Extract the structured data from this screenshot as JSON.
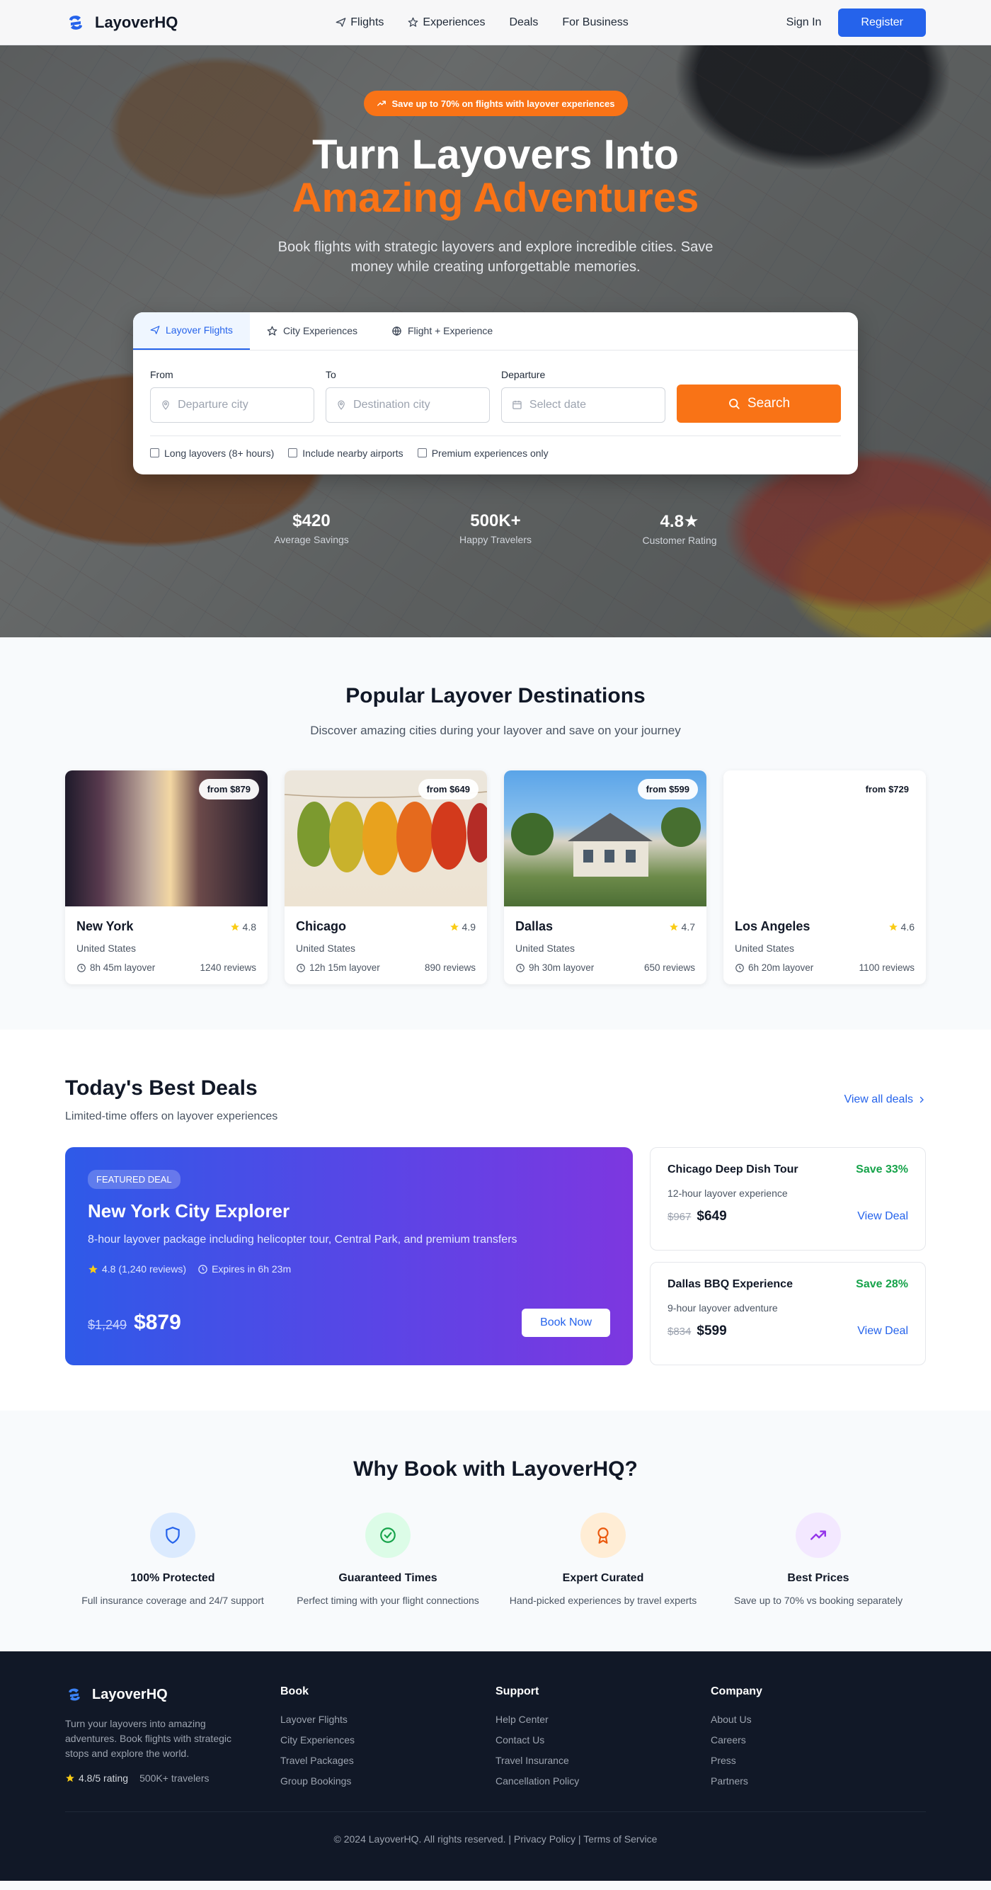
{
  "brand": {
    "name": "LayoverHQ"
  },
  "nav": {
    "links": [
      {
        "label": "Flights",
        "icon": "plane-icon"
      },
      {
        "label": "Experiences",
        "icon": "star-icon"
      },
      {
        "label": "Deals"
      },
      {
        "label": "For Business"
      }
    ],
    "sign_in": "Sign In",
    "register": "Register"
  },
  "hero": {
    "promo": "Save up to 70% on flights with layover experiences",
    "title_line1": "Turn Layovers Into",
    "title_line2": "Amazing Adventures",
    "subtitle": "Book flights with strategic layovers and explore incredible cities. Save money while creating unforgettable memories."
  },
  "search": {
    "tabs": [
      {
        "label": "Layover Flights",
        "icon": "plane-icon",
        "active": true
      },
      {
        "label": "City Experiences",
        "icon": "star-icon"
      },
      {
        "label": "Flight + Experience",
        "icon": "globe-icon"
      }
    ],
    "from_label": "From",
    "from_placeholder": "Departure city",
    "to_label": "To",
    "to_placeholder": "Destination city",
    "departure_label": "Departure",
    "departure_placeholder": "Select date",
    "button": "Search",
    "options": [
      "Long layovers (8+ hours)",
      "Include nearby airports",
      "Premium experiences only"
    ]
  },
  "stats": [
    {
      "value": "$420",
      "label": "Average Savings"
    },
    {
      "value": "500K+",
      "label": "Happy Travelers"
    },
    {
      "value": "4.8★",
      "label": "Customer Rating"
    }
  ],
  "destinations": {
    "title": "Popular Layover Destinations",
    "subtitle": "Discover amazing cities during your layover and save on your journey",
    "items": [
      {
        "city": "New York",
        "country": "United States",
        "price": "from $879",
        "rating": "4.8",
        "layover": "8h 45m layover",
        "reviews": "1240 reviews"
      },
      {
        "city": "Chicago",
        "country": "United States",
        "price": "from $649",
        "rating": "4.9",
        "layover": "12h 15m layover",
        "reviews": "890 reviews"
      },
      {
        "city": "Dallas",
        "country": "United States",
        "price": "from $599",
        "rating": "4.7",
        "layover": "9h 30m layover",
        "reviews": "650 reviews"
      },
      {
        "city": "Los Angeles",
        "country": "United States",
        "price": "from $729",
        "rating": "4.6",
        "layover": "6h 20m layover",
        "reviews": "1100 reviews"
      }
    ]
  },
  "deals": {
    "title": "Today's Best Deals",
    "subtitle": "Limited-time offers on layover experiences",
    "view_all": "View all deals",
    "featured": {
      "badge": "FEATURED DEAL",
      "title": "New York City Explorer",
      "desc": "8-hour layover package including helicopter tour, Central Park, and premium transfers",
      "rating": "4.8 (1,240 reviews)",
      "expires": "Expires in 6h 23m",
      "old_price": "$1,249",
      "new_price": "$879",
      "button": "Book Now"
    },
    "side": [
      {
        "title": "Chicago Deep Dish Tour",
        "save": "Save 33%",
        "desc": "12-hour layover experience",
        "old_price": "$967",
        "new_price": "$649",
        "link": "View Deal"
      },
      {
        "title": "Dallas BBQ Experience",
        "save": "Save 28%",
        "desc": "9-hour layover adventure",
        "old_price": "$834",
        "new_price": "$599",
        "link": "View Deal"
      }
    ]
  },
  "why": {
    "title": "Why Book with LayoverHQ?",
    "features": [
      {
        "title": "100% Protected",
        "desc": "Full insurance coverage and 24/7 support",
        "icon": "shield-icon",
        "color": "#2563eb"
      },
      {
        "title": "Guaranteed Times",
        "desc": "Perfect timing with your flight connections",
        "icon": "check-circle-icon",
        "color": "#16a34a"
      },
      {
        "title": "Expert Curated",
        "desc": "Hand-picked experiences by travel experts",
        "icon": "award-icon",
        "color": "#ea580c"
      },
      {
        "title": "Best Prices",
        "desc": "Save up to 70% vs booking separately",
        "icon": "trending-up-icon",
        "color": "#9333ea"
      }
    ]
  },
  "footer": {
    "about": "Turn your layovers into amazing adventures. Book flights with strategic stops and explore the world.",
    "rating": "4.8/5 rating",
    "travelers": "500K+ travelers",
    "columns": [
      {
        "heading": "Book",
        "links": [
          "Layover Flights",
          "City Experiences",
          "Travel Packages",
          "Group Bookings"
        ]
      },
      {
        "heading": "Support",
        "links": [
          "Help Center",
          "Contact Us",
          "Travel Insurance",
          "Cancellation Policy"
        ]
      },
      {
        "heading": "Company",
        "links": [
          "About Us",
          "Careers",
          "Press",
          "Partners"
        ]
      }
    ],
    "copyright": "© 2024 LayoverHQ. All rights reserved. | Privacy Policy | Terms of Service"
  },
  "colors": {
    "primary": "#2563eb",
    "accent": "#f97316",
    "success": "#16a34a",
    "star": "#facc15",
    "footer_bg": "#111827"
  }
}
